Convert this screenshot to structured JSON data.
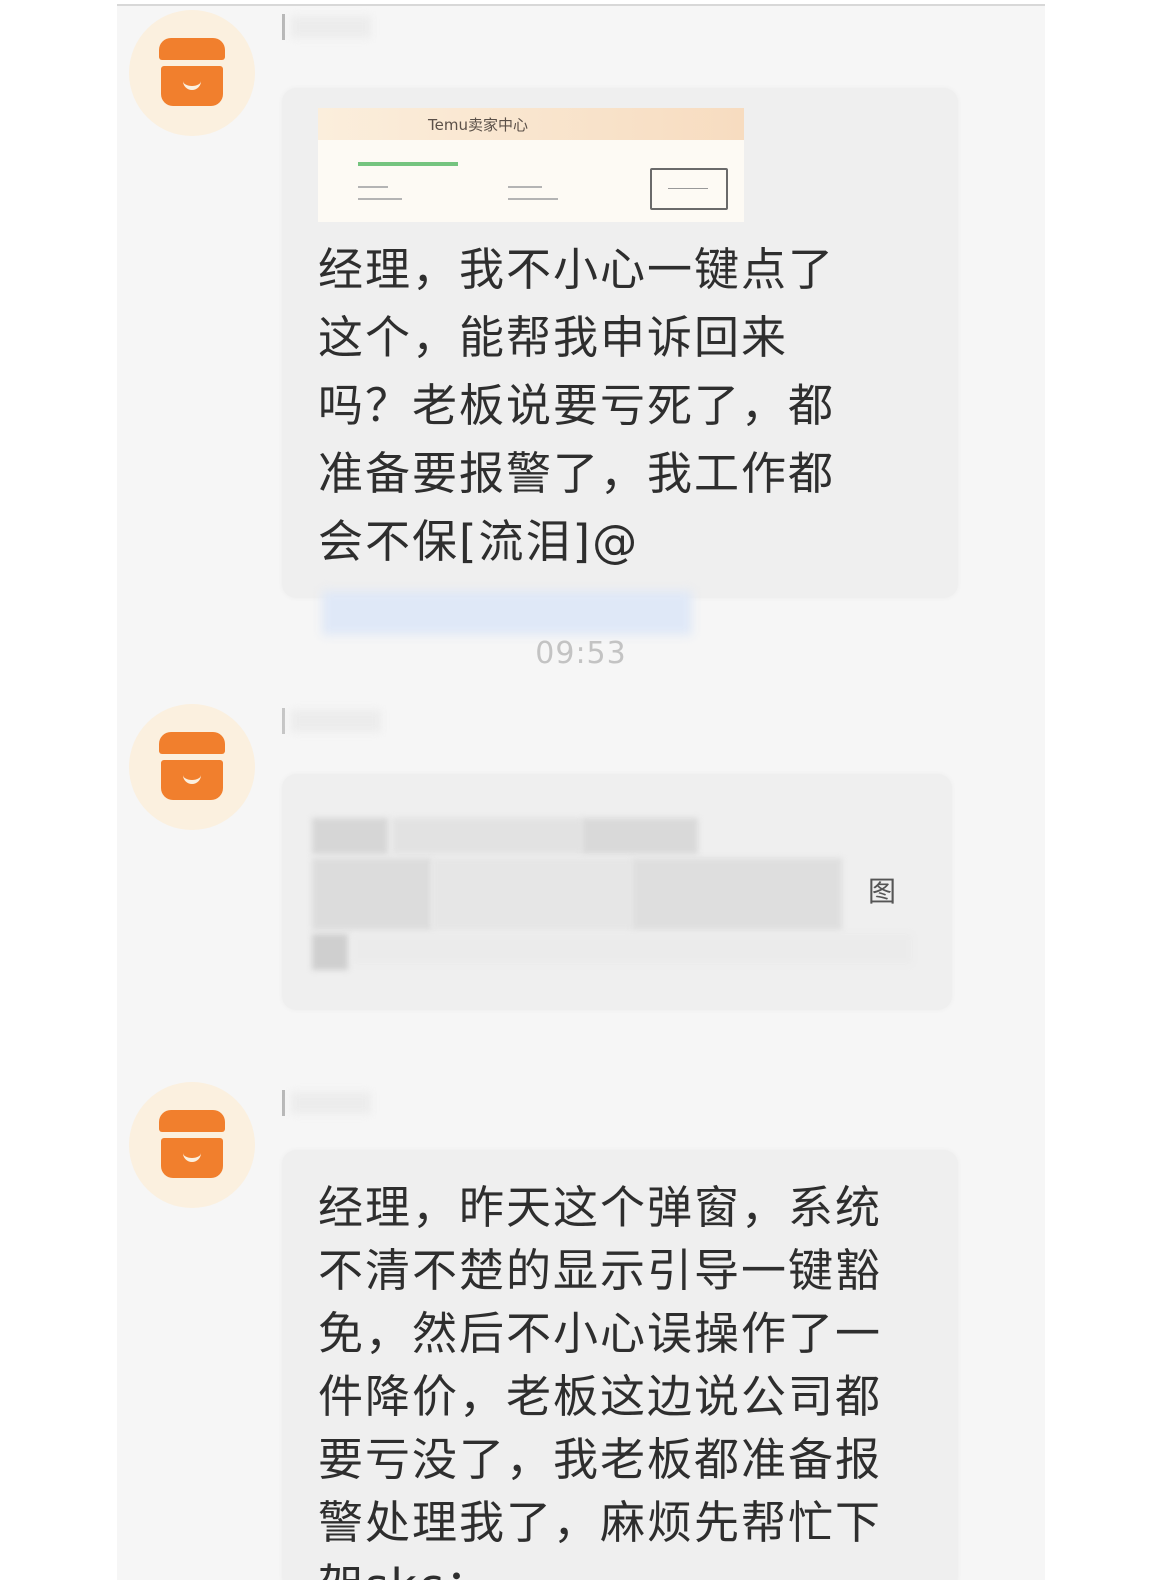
{
  "messages": [
    {
      "time": "",
      "screenshot_title": "Temu卖家中心",
      "text": "经理，我不小心一键点了这个，能帮我申诉回来吗？老板说要亏死了，都准备要报警了，我工作都会不保[流泪]@"
    },
    {
      "time": "09:53",
      "blurred_fragment": "图"
    },
    {
      "text": "经理，昨天这个弹窗，系统不清不楚的显示引导一键豁免，然后不小心误操作了一件降价，老板这边说公司都要亏没了，我老板都准备报警处理我了，麻烦先帮忙下架skc："
    }
  ],
  "colors": {
    "avatar_bg": "#fbf0df",
    "shop_icon": "#f17f2d",
    "bubble_bg": "#efefef",
    "screen_bg": "#f6f6f6"
  },
  "icons": [
    "shop-icon"
  ]
}
